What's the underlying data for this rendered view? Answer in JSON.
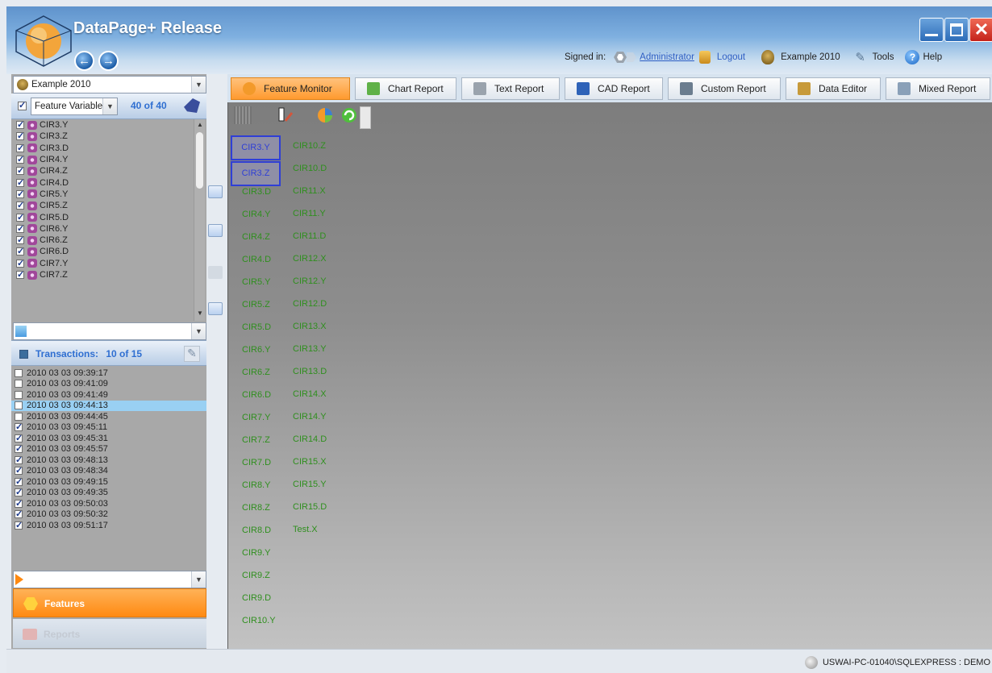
{
  "app": {
    "title": "DataPage+ Release"
  },
  "header": {
    "signed_in_label": "Signed in:",
    "user": "Administrator",
    "logout": "Logout",
    "database": "Example 2010",
    "tools": "Tools",
    "help": "Help"
  },
  "left": {
    "db_combo": "Example 2010",
    "filter_combo": "Feature Variable",
    "feature_count": "40 of 40",
    "features": [
      {
        "label": "CIR3.Y",
        "checked": true
      },
      {
        "label": "CIR3.Z",
        "checked": true
      },
      {
        "label": "CIR3.D",
        "checked": true
      },
      {
        "label": "CIR4.Y",
        "checked": true
      },
      {
        "label": "CIR4.Z",
        "checked": true
      },
      {
        "label": "CIR4.D",
        "checked": true
      },
      {
        "label": "CIR5.Y",
        "checked": true
      },
      {
        "label": "CIR5.Z",
        "checked": true
      },
      {
        "label": "CIR5.D",
        "checked": true
      },
      {
        "label": "CIR6.Y",
        "checked": true
      },
      {
        "label": "CIR6.Z",
        "checked": true
      },
      {
        "label": "CIR6.D",
        "checked": true
      },
      {
        "label": "CIR7.Y",
        "checked": true
      },
      {
        "label": "CIR7.Z",
        "checked": true
      }
    ],
    "transactions_label": "Transactions:",
    "transactions_count": "10 of 15",
    "transactions": [
      {
        "label": "2010 03 03 09:39:17",
        "checked": false,
        "selected": false
      },
      {
        "label": "2010 03 03 09:41:09",
        "checked": false,
        "selected": false
      },
      {
        "label": "2010 03 03 09:41:49",
        "checked": false,
        "selected": false
      },
      {
        "label": "2010 03 03 09:44:13",
        "checked": false,
        "selected": true
      },
      {
        "label": "2010 03 03 09:44:45",
        "checked": false,
        "selected": false
      },
      {
        "label": "2010 03 03 09:45:11",
        "checked": true,
        "selected": false
      },
      {
        "label": "2010 03 03 09:45:31",
        "checked": true,
        "selected": false
      },
      {
        "label": "2010 03 03 09:45:57",
        "checked": true,
        "selected": false
      },
      {
        "label": "2010 03 03 09:48:13",
        "checked": true,
        "selected": false
      },
      {
        "label": "2010 03 03 09:48:34",
        "checked": true,
        "selected": false
      },
      {
        "label": "2010 03 03 09:49:15",
        "checked": true,
        "selected": false
      },
      {
        "label": "2010 03 03 09:49:35",
        "checked": true,
        "selected": false
      },
      {
        "label": "2010 03 03 09:50:03",
        "checked": true,
        "selected": false
      },
      {
        "label": "2010 03 03 09:50:32",
        "checked": true,
        "selected": false
      },
      {
        "label": "2010 03 03 09:51:17",
        "checked": true,
        "selected": false
      }
    ],
    "nav_features": "Features",
    "nav_reports": "Reports"
  },
  "tabs": [
    {
      "label": "Feature Monitor",
      "icon": "pie-chart-icon",
      "active": true
    },
    {
      "label": "Chart Report",
      "icon": "bar-chart-icon",
      "active": false
    },
    {
      "label": "Text Report",
      "icon": "text-document-icon",
      "active": false
    },
    {
      "label": "CAD Report",
      "icon": "cad-icon",
      "active": false
    },
    {
      "label": "Custom Report",
      "icon": "custom-report-icon",
      "active": false
    },
    {
      "label": "Data Editor",
      "icon": "data-editor-icon",
      "active": false
    },
    {
      "label": "Mixed Report",
      "icon": "mixed-report-icon",
      "active": false
    }
  ],
  "monitor": {
    "col1": [
      "CIR3.Y",
      "CIR3.Z",
      "CIR3.D",
      "CIR4.Y",
      "CIR4.Z",
      "CIR4.D",
      "CIR5.Y",
      "CIR5.Z",
      "CIR5.D",
      "CIR6.Y",
      "CIR6.Z",
      "CIR6.D",
      "CIR7.Y",
      "CIR7.Z",
      "CIR7.D",
      "CIR8.Y",
      "CIR8.Z",
      "CIR8.D",
      "CIR9.Y",
      "CIR9.Z",
      "CIR9.D",
      "CIR10.Y"
    ],
    "col2": [
      "CIR10.Z",
      "CIR10.D",
      "CIR11.X",
      "CIR11.Y",
      "CIR11.D",
      "CIR12.X",
      "CIR12.Y",
      "CIR12.D",
      "CIR13.X",
      "CIR13.Y",
      "CIR13.D",
      "CIR14.X",
      "CIR14.Y",
      "CIR14.D",
      "CIR15.X",
      "CIR15.Y",
      "CIR15.D",
      "Test.X"
    ],
    "selected": [
      "CIR3.Y",
      "CIR3.Z"
    ]
  },
  "status": {
    "connection": "USWAI-PC-01040\\SQLEXPRESS : DEMO"
  },
  "colors": {
    "accent_orange": "#ff9a2e",
    "link_blue": "#2f6fd1",
    "feature_green": "#2f8f1e",
    "select_blue": "#2f3fd6"
  }
}
